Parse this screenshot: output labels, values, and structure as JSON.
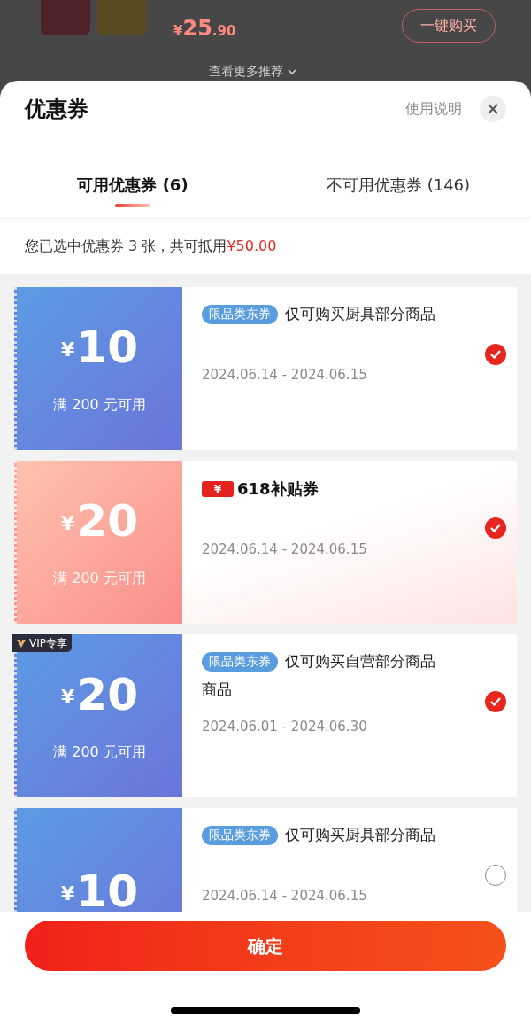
{
  "background": {
    "product": {
      "price_currency": "¥",
      "price_integer": "25",
      "price_decimal": ".90",
      "buy_button": "一键购买"
    },
    "more_link": "查看更多推荐"
  },
  "sheet": {
    "title": "优惠券",
    "help_link": "使用说明",
    "tabs": [
      {
        "label": "可用优惠券 (6)",
        "selected": true
      },
      {
        "label": "不可用优惠券 (146)",
        "selected": false
      }
    ],
    "summary": {
      "text": "您已选中优惠券 3 张，共可抵用",
      "amount": "¥50.00"
    },
    "coupons": [
      {
        "kind": "standard",
        "currency": "¥",
        "amount": "10",
        "condition": "满 200 元可用",
        "tag": "限品类东券",
        "description": "仅可购买厨具部分商品",
        "date": "2024.06.14 - 2024.06.15",
        "selected": true
      },
      {
        "kind": "promo",
        "currency": "¥",
        "amount": "20",
        "condition": "满 200 元可用",
        "ticket_symbol": "¥",
        "promo_label": "618补贴券",
        "date": "2024.06.14 - 2024.06.15",
        "selected": true
      },
      {
        "kind": "standard",
        "badge": "VIP专享",
        "currency": "¥",
        "amount": "20",
        "condition": "满 200 元可用",
        "tag": "限品类东券",
        "description": "仅可购买自营部分商品",
        "extra_line": "商品",
        "date": "2024.06.01 - 2024.06.30",
        "selected": true
      },
      {
        "kind": "standard",
        "currency": "¥",
        "amount": "10",
        "tag": "限品类东券",
        "description": "仅可购买厨具部分商品",
        "date": "2024.06.14 - 2024.06.15",
        "selected": false
      }
    ],
    "confirm_button": "确定"
  }
}
